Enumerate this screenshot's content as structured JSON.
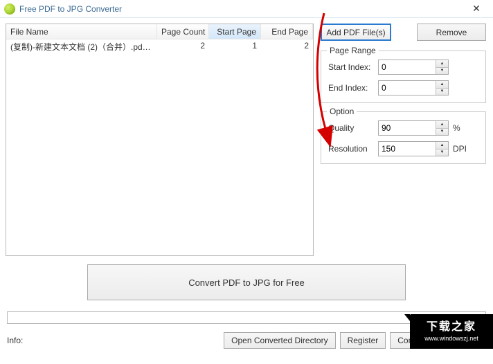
{
  "window": {
    "title": "Free PDF to JPG Converter",
    "close_icon": "✕"
  },
  "table": {
    "headers": {
      "filename": "File Name",
      "pagecount": "Page Count",
      "startpage": "Start Page",
      "endpage": "End Page"
    },
    "rows": [
      {
        "filename": "(复制)-新建文本文档 (2)（合并）.pdf-...",
        "pagecount": "2",
        "startpage": "1",
        "endpage": "2"
      }
    ]
  },
  "buttons": {
    "add": "Add PDF File(s)",
    "remove": "Remove",
    "convert": "Convert PDF to JPG for Free",
    "open_dir": "Open Converted Directory",
    "register": "Register",
    "cmdline": "Command Line, Site L"
  },
  "page_range": {
    "legend": "Page Range",
    "start_label": "Start Index:",
    "start_value": "0",
    "end_label": "End Index:",
    "end_value": "0"
  },
  "option": {
    "legend": "Option",
    "quality_label": "Quality",
    "quality_value": "90",
    "quality_unit": "%",
    "resolution_label": "Resolution",
    "resolution_value": "150",
    "resolution_unit": "DPI"
  },
  "footer": {
    "info_label": "Info:"
  },
  "watermark": {
    "zh": "下载之家",
    "url": " www.windowszj.net"
  }
}
